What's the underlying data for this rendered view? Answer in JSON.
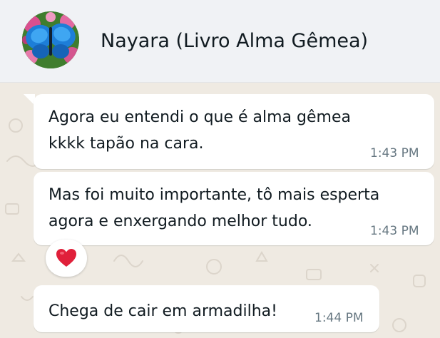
{
  "header": {
    "contact_name": "Nayara (Livro Alma Gêmea)",
    "avatar_icon": "butterfly-on-flowers"
  },
  "messages": [
    {
      "lines": [
        "Agora eu entendi o que é alma gêmea",
        "kkkk tapão na cara."
      ],
      "time": "1:43 PM"
    },
    {
      "lines": [
        "Mas foi muito importante, tô mais esperta",
        "agora e enxergando melhor tudo."
      ],
      "time": "1:43 PM",
      "reaction": "red-heart-icon"
    },
    {
      "lines": [
        "Chega de cair em armadilha!"
      ],
      "time": "1:44 PM"
    }
  ],
  "colors": {
    "header_bg": "#f0f2f5",
    "chat_bg": "#efeae2",
    "bubble_bg": "#ffffff",
    "text": "#111b21",
    "timestamp": "#667781",
    "heart": "#e0203a"
  }
}
